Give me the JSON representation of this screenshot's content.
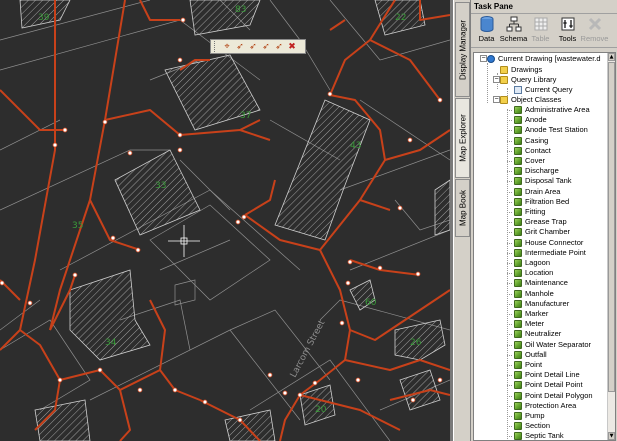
{
  "map": {
    "street_label": "Larcom Street",
    "parcel_labels": [
      "83",
      "39",
      "37",
      "33",
      "43",
      "35",
      "22",
      "34",
      "26",
      "60",
      "20"
    ]
  },
  "map_toolbar": {
    "icons": [
      "select-vertex-icon",
      "edit-arrow-icon",
      "edit-arrow-icon",
      "edit-arrow-icon",
      "edit-arrow-icon",
      "delete-vertex-icon"
    ]
  },
  "side_tabs": [
    "Display Manager",
    "Map Explorer",
    "Map Book"
  ],
  "task_pane": {
    "title": "Task Pane",
    "toolbar": [
      {
        "label": "Data",
        "icon": "data-icon",
        "enabled": true
      },
      {
        "label": "Schema",
        "icon": "schema-icon",
        "enabled": true
      },
      {
        "label": "Table",
        "icon": "table-icon",
        "enabled": false
      },
      {
        "label": "Tools",
        "icon": "tools-icon",
        "enabled": true
      },
      {
        "label": "Remove",
        "icon": "remove-icon",
        "enabled": false
      }
    ],
    "tree": {
      "root": "Current Drawing [wastewater.d",
      "drawings": "Drawings",
      "query_library": "Query Library",
      "current_query": "Current Query",
      "object_classes": "Object Classes",
      "classes": [
        "Administrative Area",
        "Anode",
        "Anode Test Station",
        "Casing",
        "Contact",
        "Cover",
        "Discharge",
        "Disposal Tank",
        "Drain Area",
        "Filtration Bed",
        "Fitting",
        "Grease Trap",
        "Grit Chamber",
        "House Connector",
        "Intermediate Point",
        "Lagoon",
        "Location",
        "Maintenance",
        "Manhole",
        "Manufacturer",
        "Marker",
        "Meter",
        "Neutralizer",
        "Oil Water Separator",
        "Outfall",
        "Point",
        "Point Detail Line",
        "Point Detail Point",
        "Point Detail Polygon",
        "Protection Area",
        "Pump",
        "Section",
        "Septic Tank"
      ]
    }
  },
  "colors": {
    "map_background": "#2d2d2d",
    "pipe": "#c8411a",
    "parcel_outline": "#bfbfbf",
    "parcel_label": "#3a9a3a",
    "pane_background": "#d4d0c8"
  }
}
